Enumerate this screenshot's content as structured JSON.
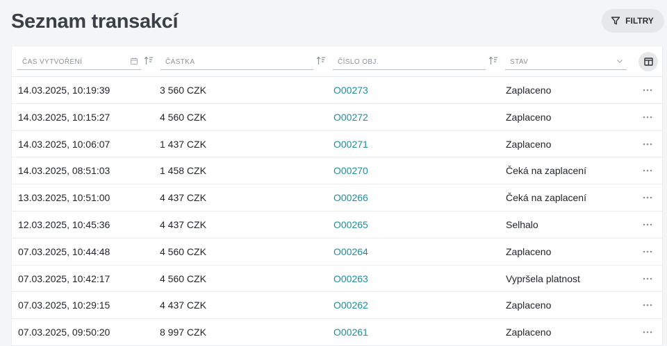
{
  "page": {
    "title": "Seznam transakcí"
  },
  "toolbar": {
    "filter_label": "FILTRY"
  },
  "colors": {
    "link": "#1b8ea0",
    "title": "#3a4047",
    "button_bg": "#e5e7e9"
  },
  "table": {
    "columns": [
      {
        "label": "ČAS VYTVOŘENÍ",
        "icon": "calendar-icon",
        "sortable": true
      },
      {
        "label": "ČÁSTKA",
        "sortable": true
      },
      {
        "label": "ČÍSLO OBJ.",
        "sortable": true
      },
      {
        "label": "STAV",
        "icon": "chevron-down-icon"
      }
    ],
    "rows": [
      {
        "time": "14.03.2025, 10:19:39",
        "amount": "3 560 CZK",
        "order": "O00273",
        "state": "Zaplaceno"
      },
      {
        "time": "14.03.2025, 10:15:27",
        "amount": "4 560 CZK",
        "order": "O00272",
        "state": "Zaplaceno"
      },
      {
        "time": "14.03.2025, 10:06:07",
        "amount": "1 437 CZK",
        "order": "O00271",
        "state": "Zaplaceno"
      },
      {
        "time": "14.03.2025, 08:51:03",
        "amount": "1 458 CZK",
        "order": "O00270",
        "state": "Čeká na zaplacení"
      },
      {
        "time": "13.03.2025, 10:51:00",
        "amount": "4 437 CZK",
        "order": "O00266",
        "state": "Čeká na zaplacení"
      },
      {
        "time": "12.03.2025, 10:45:36",
        "amount": "4 437 CZK",
        "order": "O00265",
        "state": "Selhalo"
      },
      {
        "time": "07.03.2025, 10:44:48",
        "amount": "4 560 CZK",
        "order": "O00264",
        "state": "Zaplaceno"
      },
      {
        "time": "07.03.2025, 10:42:17",
        "amount": "4 560 CZK",
        "order": "O00263",
        "state": "Vypršela platnost"
      },
      {
        "time": "07.03.2025, 10:29:15",
        "amount": "4 437 CZK",
        "order": "O00262",
        "state": "Zaplaceno"
      },
      {
        "time": "07.03.2025, 09:50:20",
        "amount": "8 997 CZK",
        "order": "O00261",
        "state": "Zaplaceno"
      }
    ]
  }
}
